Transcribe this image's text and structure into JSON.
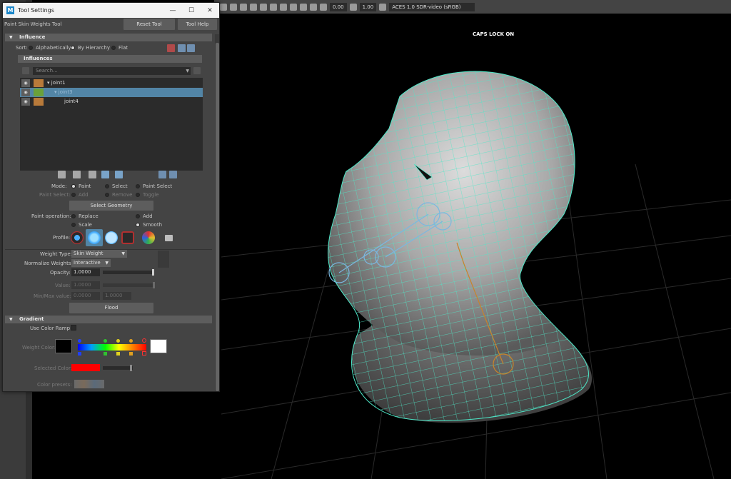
{
  "viewport": {
    "exposure": "0.00",
    "gamma": "1.00",
    "color_space": "ACES 1.0 SDR-video (sRGB)",
    "caps_lock": "CAPS LOCK ON"
  },
  "window": {
    "title": "Tool Settings",
    "minimize": "—",
    "maximize": "☐",
    "close": "✕"
  },
  "tool": {
    "name": "Paint Skin Weights Tool",
    "reset_label": "Reset Tool",
    "help_label": "Tool Help"
  },
  "influence": {
    "header": "Influence",
    "sort_label": "Sort:",
    "sort_options": [
      "Alphabetically",
      "By Hierarchy",
      "Flat"
    ],
    "sort_selected": "By Hierarchy",
    "influences_header": "Influences",
    "search_placeholder": "Search...",
    "items": [
      {
        "name": "joint1",
        "color": "#b87a3a"
      },
      {
        "name": "joint3",
        "color": "#6aa13a"
      },
      {
        "name": "joint4",
        "color": "#b87a3a"
      }
    ]
  },
  "mode": {
    "label": "Mode:",
    "options": [
      "Paint",
      "Select",
      "Paint Select"
    ],
    "selected": "Paint",
    "paint_select_label": "Paint Select:",
    "paint_select_options": [
      "Add",
      "Remove",
      "Toggle"
    ],
    "select_geometry_label": "Select Geometry"
  },
  "paint_operation": {
    "label": "Paint operation:",
    "options": [
      "Replace",
      "Add",
      "Scale",
      "Smooth"
    ],
    "selected": "Smooth"
  },
  "profile": {
    "label": "Profile:"
  },
  "weights": {
    "weight_type_label": "Weight Type:",
    "weight_type_value": "Skin Weight",
    "normalize_label": "Normalize Weights:",
    "normalize_value": "Interactive",
    "opacity_label": "Opacity:",
    "opacity_value": "1.0000",
    "opacity_level": 1.0,
    "value_label": "Value:",
    "value_value": "1.0000",
    "minmax_label": "Min/Max value:",
    "min_value": "0.0000",
    "max_value": "1.0000",
    "flood_label": "Flood"
  },
  "gradient": {
    "header": "Gradient",
    "use_color_ramp_label": "Use Color Ramp",
    "weight_color_label": "Weight Color:",
    "selected_color_label": "Selected Color:",
    "selected_color": "#ff0000",
    "color_presets_label": "Color presets:"
  },
  "colors": {
    "panel_bg": "#444444",
    "section_header": "#5d5d5d",
    "selection_blue": "#5285a6",
    "wire_cyan": "#4ee8c8",
    "mesh_gray": "#888888"
  }
}
